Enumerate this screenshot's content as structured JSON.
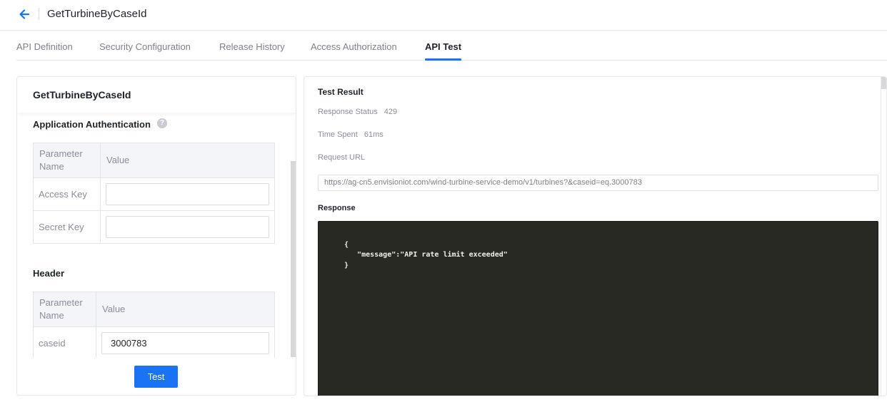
{
  "header": {
    "back_icon": "arrow-left-icon",
    "title": "GetTurbineByCaseId"
  },
  "tabs": [
    {
      "label": "API Definition",
      "active": false
    },
    {
      "label": "Security Configuration",
      "active": false
    },
    {
      "label": "Release History",
      "active": false
    },
    {
      "label": "Access Authorization",
      "active": false
    },
    {
      "label": "API Test",
      "active": true
    }
  ],
  "left_panel": {
    "title": "GetTurbineByCaseId",
    "app_auth": {
      "title": "Application Authentication",
      "help_icon": "question-circle-icon",
      "columns": [
        "Parameter Name",
        "Value"
      ],
      "rows": [
        {
          "name": "Access Key",
          "value": ""
        },
        {
          "name": "Secret Key",
          "value": ""
        }
      ]
    },
    "header_section": {
      "title": "Header",
      "columns": [
        "Parameter Name",
        "Value"
      ],
      "rows": [
        {
          "name": "caseid",
          "value": "3000783"
        }
      ]
    },
    "test_button": "Test"
  },
  "right_panel": {
    "title": "Test Result",
    "response_status_label": "Response Status",
    "response_status": "429",
    "time_spent_label": "Time Spent",
    "time_spent": "61ms",
    "request_url_label": "Request URL",
    "request_url": "https://ag-cn5.envisioniot.com/wind-turbine-service-demo/v1/turbines?&caseid=eq.3000783",
    "response_label": "Response",
    "response_lines": [
      "{",
      "   \"message\":\"API rate limit exceeded\"",
      "}"
    ]
  },
  "colors": {
    "accent": "#1a73f5",
    "code_bg": "#282923"
  }
}
